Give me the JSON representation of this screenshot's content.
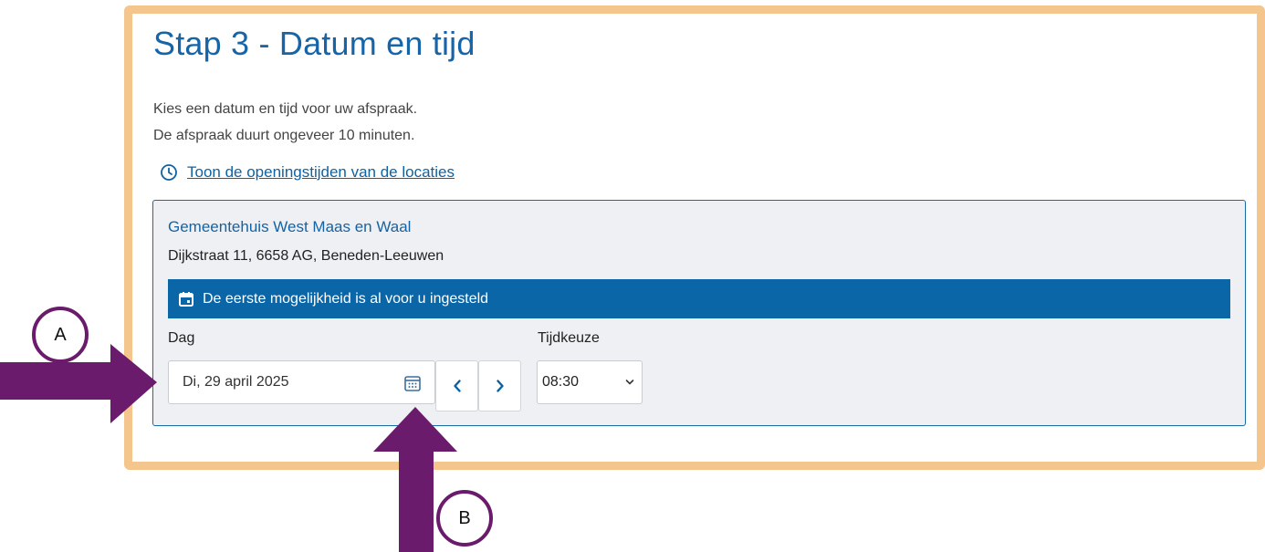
{
  "page": {
    "title": "Stap 3 - Datum en tijd",
    "intro_line1": "Kies een datum en tijd voor uw afspraak.",
    "intro_line2": "De afspraak duurt ongeveer 10 minuten.",
    "hours_link": "Toon de openingstijden van de locaties"
  },
  "location": {
    "name": "Gemeentehuis West Maas en Waal",
    "address": "Dijkstraat 11, 6658 AG, Beneden-Leeuwen",
    "banner": "De eerste mogelijkheid is al voor u ingesteld"
  },
  "form": {
    "day_label": "Dag",
    "day_value": "Di, 29 april 2025",
    "time_label": "Tijdkeuze",
    "time_value": "08:30"
  },
  "annotations": {
    "marker_a": "A",
    "marker_b": "B"
  },
  "colors": {
    "frame": "#f4c68d",
    "accent": "#0b66a8",
    "arrow": "#6a1b6b"
  },
  "icons": {
    "hours": "clock-icon",
    "banner": "calendar-icon",
    "date": "calendar-grid-icon",
    "prev": "chevron-left-icon",
    "next": "chevron-right-icon",
    "select": "chevron-down-icon"
  }
}
